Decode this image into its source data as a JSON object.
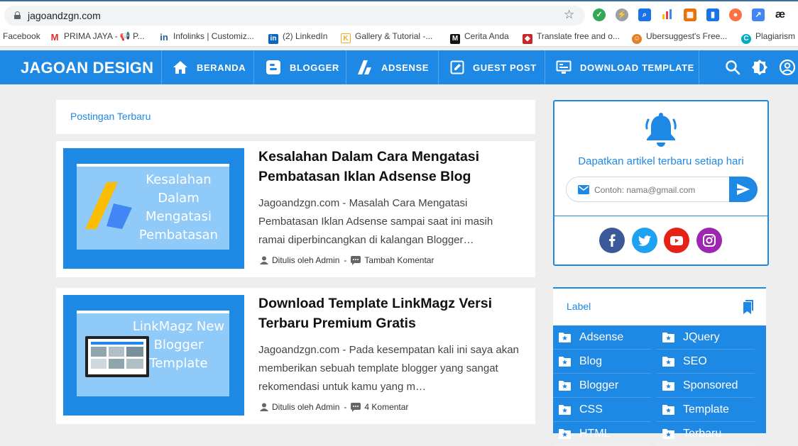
{
  "browser": {
    "url": "jagoandzgn.com",
    "bookmarks": [
      {
        "label": "Facebook",
        "color": "#1877f2"
      },
      {
        "label": "PRIMA JAYA - 📢 P...",
        "color": "#d93025"
      },
      {
        "label": "Infolinks | Customiz...",
        "color": "#2a5d8f"
      },
      {
        "label": "(2) LinkedIn",
        "color": "#0a66c2"
      },
      {
        "label": "Gallery & Tutorial -...",
        "color": "#f9a825"
      },
      {
        "label": "Cerita Anda",
        "color": "#111111"
      },
      {
        "label": "Translate free and o...",
        "color": "#c62828"
      },
      {
        "label": "Ubersuggest's Free...",
        "color": "#e67e22"
      },
      {
        "label": "Plagiarism",
        "color": "#00acc1"
      }
    ],
    "extension_label": "æ"
  },
  "nav": {
    "brand": "JAGOAN DESIGN",
    "items": [
      {
        "label": "BERANDA",
        "icon": "home-icon"
      },
      {
        "label": "BLOGGER",
        "icon": "blogger-icon"
      },
      {
        "label": "ADSENSE",
        "icon": "adsense-icon"
      },
      {
        "label": "GUEST POST",
        "icon": "edit-icon"
      },
      {
        "label": "DOWNLOAD TEMPLATE",
        "icon": "monitor-icon"
      }
    ]
  },
  "main": {
    "section_title": "Postingan Terbaru",
    "posts": [
      {
        "thumb_text": "Kesalahan Dalam Mengatasi Pembatasan",
        "title": "Kesalahan Dalam Cara Mengatasi Pembatasan Iklan Adsense Blog",
        "excerpt": "Jagoandzgn.com - Masalah Cara Mengatasi Pembatasan Iklan Adsense sampai saat ini masih ramai diperbincangkan di kalangan Blogger…",
        "author": "Ditulis oleh Admin",
        "comments": "Tambah Komentar"
      },
      {
        "thumb_text": "LinkMagz New Blogger Template",
        "title": "Download Template LinkMagz Versi Terbaru Premium Gratis",
        "excerpt": "Jagoandzgn.com - Pada kesempatan kali ini saya akan memberikan sebuah template blogger yang sangat rekomendasi untuk kamu yang m…",
        "author": "Ditulis oleh Admin",
        "comments": "4 Komentar"
      }
    ]
  },
  "sidebar": {
    "subscribe_text": "Dapatkan artikel terbaru setiap hari",
    "email_placeholder": "Contoh: nama@gmail.com",
    "social": [
      {
        "name": "facebook",
        "color": "#3b5998"
      },
      {
        "name": "twitter",
        "color": "#1da1f2"
      },
      {
        "name": "youtube",
        "color": "#e62117"
      },
      {
        "name": "instagram",
        "color": "#9c27b0"
      }
    ],
    "label_title": "Label",
    "labels_left": [
      "Adsense",
      "Blog",
      "Blogger",
      "CSS",
      "HTML"
    ],
    "labels_right": [
      "JQuery",
      "SEO",
      "Sponsored",
      "Template",
      "Terbaru"
    ]
  },
  "colors": {
    "primary": "#1e88e5",
    "background": "#eeeeee"
  }
}
